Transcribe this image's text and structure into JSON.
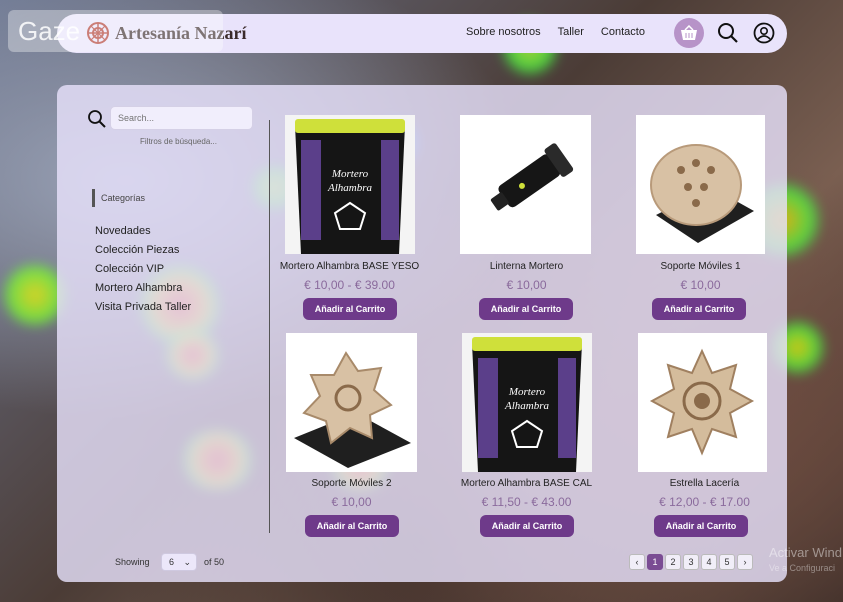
{
  "overlay": {
    "gaze_label": "Gaze"
  },
  "brand": {
    "name": "Artesanía Nazarí"
  },
  "nav": {
    "links": [
      "Sobre nosotros",
      "Taller",
      "Contacto"
    ]
  },
  "sidebar": {
    "search_placeholder": "Search...",
    "filters_label": "Filtros de búsqueda...",
    "categories_title": "Categorías",
    "categories": [
      "Novedades",
      "Colección Piezas",
      "Colección VIP",
      "Mortero Alhambra",
      "Visita Privada Taller"
    ]
  },
  "products": [
    {
      "name": "Mortero Alhambra BASE YESO",
      "price": "€ 10,00 - € 39.00",
      "button": "Añadir al Carrito"
    },
    {
      "name": "Linterna Mortero",
      "price": "€ 10,00",
      "button": "Añadir al Carrito"
    },
    {
      "name": "Soporte Móviles 1",
      "price": "€ 10,00",
      "button": "Añadir al Carrito"
    },
    {
      "name": "Soporte Móviles 2",
      "price": "€ 10,00",
      "button": "Añadir al Carrito"
    },
    {
      "name": "Mortero Alhambra BASE CAL",
      "price": "€ 11,50 - € 43.00",
      "button": "Añadir al Carrito"
    },
    {
      "name": "Estrella Lacería",
      "price": "€ 12,00 - € 17.00",
      "button": "Añadir al Carrito"
    }
  ],
  "pagination": {
    "showing_label": "Showing",
    "per_page": "6",
    "of_total": "of 50",
    "pages": [
      "1",
      "2",
      "3",
      "4",
      "5"
    ],
    "active_page": "1",
    "prev": "‹",
    "next": "›"
  },
  "watermark": {
    "line1": "Activar Wind",
    "line2": "Ve a Configuraci"
  },
  "colors": {
    "accent": "#6e3a8a",
    "navbar_bg": "#e9e3fb",
    "panel_bg": "#e7e1fa",
    "price": "#8a6a9c",
    "cart": "#b793c8"
  },
  "icons": {
    "brand": "rosette-logo-icon",
    "cart": "basket-icon",
    "search": "search-icon",
    "user": "user-circle-icon"
  }
}
